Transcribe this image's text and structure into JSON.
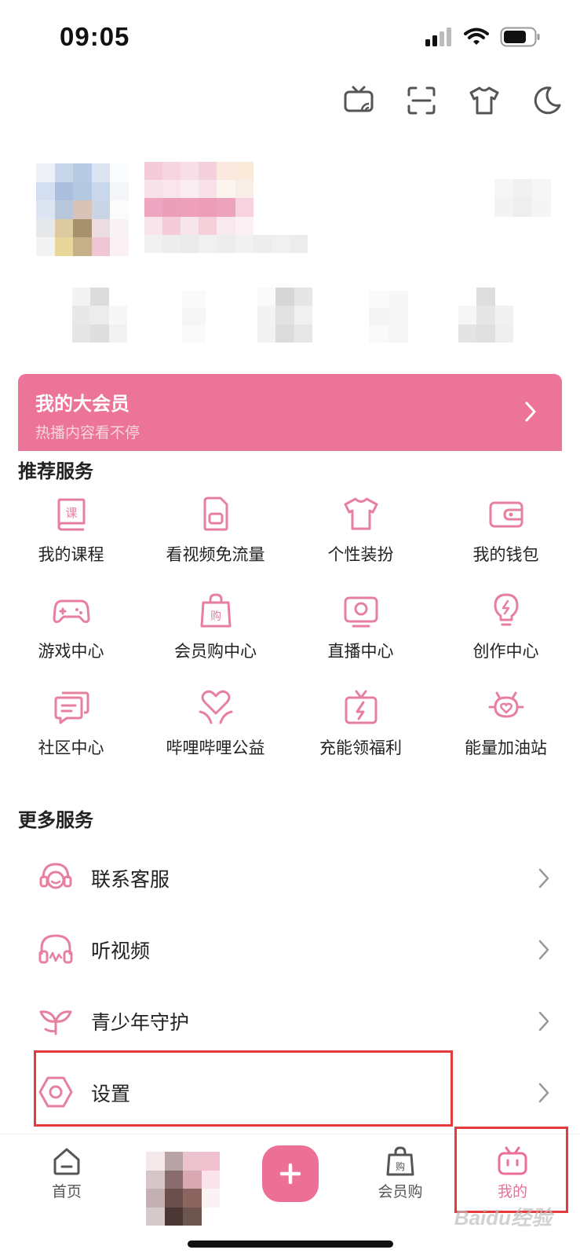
{
  "status": {
    "time": "09:05"
  },
  "vip": {
    "title": "我的大会员",
    "subtitle": "热播内容看不停"
  },
  "recommended": {
    "title": "推荐服务",
    "items": [
      {
        "label": "我的课程",
        "icon": "course-book-icon"
      },
      {
        "label": "看视频免流量",
        "icon": "sim-card-icon"
      },
      {
        "label": "个性装扮",
        "icon": "tshirt-icon"
      },
      {
        "label": "我的钱包",
        "icon": "wallet-icon"
      },
      {
        "label": "游戏中心",
        "icon": "gamepad-icon"
      },
      {
        "label": "会员购中心",
        "icon": "shopping-bag-icon"
      },
      {
        "label": "直播中心",
        "icon": "live-tv-icon"
      },
      {
        "label": "创作中心",
        "icon": "lightbulb-icon"
      },
      {
        "label": "社区中心",
        "icon": "chat-bubbles-icon"
      },
      {
        "label": "哔哩哔哩公益",
        "icon": "heart-hands-icon"
      },
      {
        "label": "充能领福利",
        "icon": "gift-bolt-icon"
      },
      {
        "label": "能量加油站",
        "icon": "energy-heart-icon"
      }
    ]
  },
  "more": {
    "title": "更多服务",
    "items": [
      {
        "label": "联系客服",
        "icon": "headset-icon"
      },
      {
        "label": "听视频",
        "icon": "headphones-icon"
      },
      {
        "label": "青少年守护",
        "icon": "sprout-icon"
      },
      {
        "label": "设置",
        "icon": "gear-hexagon-icon"
      }
    ]
  },
  "tabs": {
    "home": "首页",
    "shop": "会员购",
    "mine": "我的",
    "active": "mine"
  },
  "watermark": "Baidu经验",
  "colors": {
    "accent": "#ec6f95",
    "banner": "#ec7499",
    "highlight": "#e33b3b"
  }
}
